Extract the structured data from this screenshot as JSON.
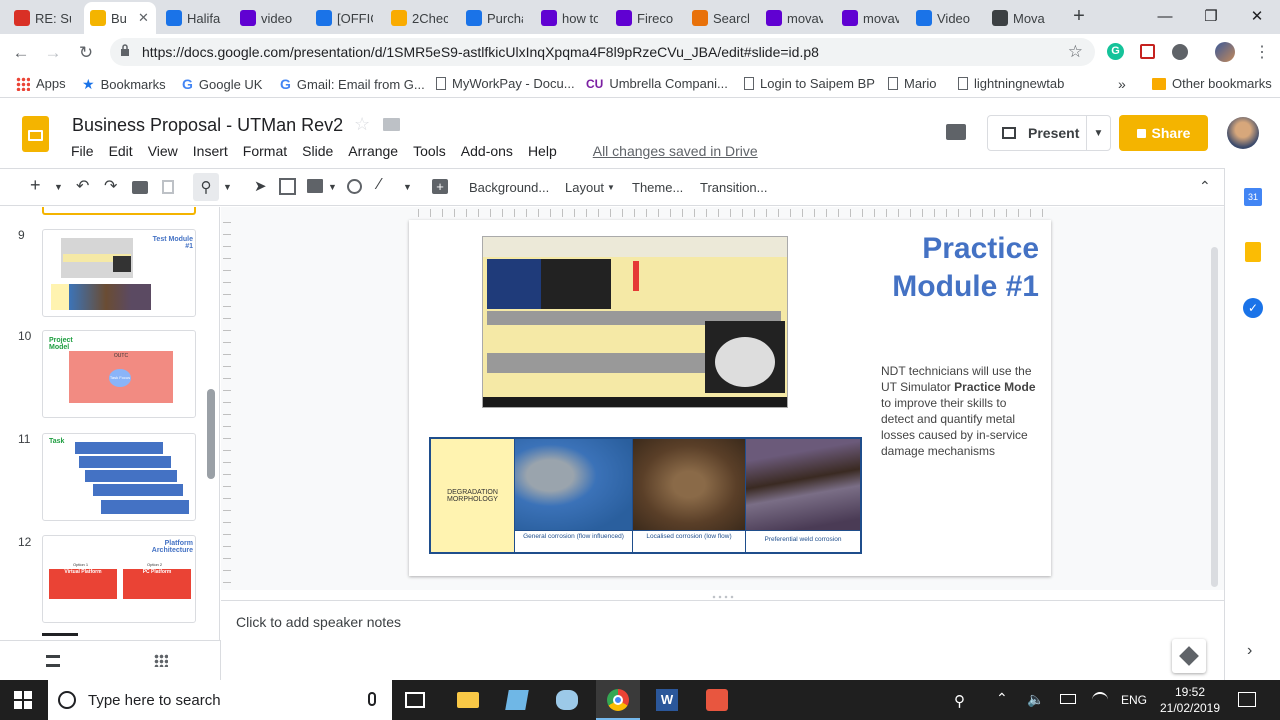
{
  "browser": {
    "tabs": [
      {
        "title": "RE: Su",
        "icon": "gmail-icon",
        "color": "#d93025",
        "active": false
      },
      {
        "title": "Bu",
        "icon": "slides-icon",
        "color": "#f4b400",
        "active": true
      },
      {
        "title": "Halifa",
        "icon": "halifax-icon",
        "color": "#1a73e8",
        "active": false
      },
      {
        "title": "video",
        "icon": "yahoo-icon",
        "color": "#6001d2",
        "active": false
      },
      {
        "title": "[OFFIC",
        "icon": "dotnet-icon",
        "color": "#1a73e8",
        "active": false
      },
      {
        "title": "2Chec",
        "icon": "lock-icon",
        "color": "#f9ab00",
        "active": false
      },
      {
        "title": "Purcha",
        "icon": "dotnet-icon",
        "color": "#1a73e8",
        "active": false
      },
      {
        "title": "how to",
        "icon": "yahoo-icon",
        "color": "#6001d2",
        "active": false
      },
      {
        "title": "Fireco",
        "icon": "yahoo-icon",
        "color": "#6001d2",
        "active": false
      },
      {
        "title": "Search",
        "icon": "search-sparkle-icon",
        "color": "#e8710a",
        "active": false
      },
      {
        "title": "movav",
        "icon": "yahoo-icon",
        "color": "#6001d2",
        "active": false
      },
      {
        "title": "movav",
        "icon": "yahoo-icon",
        "color": "#6001d2",
        "active": false
      },
      {
        "title": "Video",
        "icon": "dotnet-icon",
        "color": "#1a73e8",
        "active": false
      },
      {
        "title": "Mova",
        "icon": "movavi-icon",
        "color": "#3c4043",
        "active": false
      }
    ],
    "url": "https://docs.google.com/presentation/d/1SMR5eS9-astlfkicUlxInqXpqma4F8l9pRzeCVu_JBA/edit#slide=id.p8",
    "bookmarks": [
      {
        "label": "Apps",
        "icon": "apps-grid-icon"
      },
      {
        "label": "Bookmarks",
        "icon": "star-icon"
      },
      {
        "label": "Google UK",
        "icon": "google-icon"
      },
      {
        "label": "Gmail: Email from G...",
        "icon": "google-icon"
      },
      {
        "label": "MyWorkPay - Docu...",
        "icon": "page-icon"
      },
      {
        "label": "Umbrella Compani...",
        "icon": "cu-icon"
      },
      {
        "label": "Login to Saipem BP",
        "icon": "page-icon"
      },
      {
        "label": "Mario",
        "icon": "page-icon"
      },
      {
        "label": "lightningnewtab",
        "icon": "page-icon"
      }
    ],
    "more_bookmarks": "»",
    "other_bookmarks": "Other bookmarks"
  },
  "doc": {
    "title": "Business Proposal - UTMan Rev2",
    "menu": [
      "File",
      "Edit",
      "View",
      "Insert",
      "Format",
      "Slide",
      "Arrange",
      "Tools",
      "Add-ons",
      "Help"
    ],
    "save_status": "All changes saved in Drive",
    "present_label": "Present",
    "share_label": "Share"
  },
  "edit_toolbar": {
    "background": "Background...",
    "layout": "Layout",
    "theme": "Theme...",
    "transition": "Transition..."
  },
  "filmstrip": {
    "slides": [
      {
        "num": "9",
        "title": "Test Module #1"
      },
      {
        "num": "10",
        "title": "Project Model"
      },
      {
        "num": "11",
        "title": "Task"
      },
      {
        "num": "12",
        "title": "Platform Architecture"
      }
    ],
    "thumb10": {
      "center": "OUTC",
      "hub": "Task Focus"
    },
    "thumb12": {
      "option1": "Option 1",
      "option2": "Option 2",
      "box1": "Virtual Platform",
      "box2": "PC Platform"
    }
  },
  "slide": {
    "title_line1": "Practice",
    "title_line2": "Module #1",
    "body_before": "NDT technicians will use the UT Simulator ",
    "body_bold": "Practice Mode",
    "body_after": " to improve their skills to detect and quantify metal losses caused by in-service damage mechanisms",
    "degradation_label": "DEGRADATION MORPHOLOGY",
    "captions": [
      "General corrosion (flow influenced)",
      "Localised corrosion (low flow)",
      "Preferential weld corrosion"
    ],
    "title_color": "#4472c4"
  },
  "notes": {
    "placeholder": "Click to add speaker notes"
  },
  "taskbar": {
    "search_placeholder": "Type here to search",
    "time": "19:52",
    "date": "21/02/2019",
    "lang": "ENG"
  }
}
